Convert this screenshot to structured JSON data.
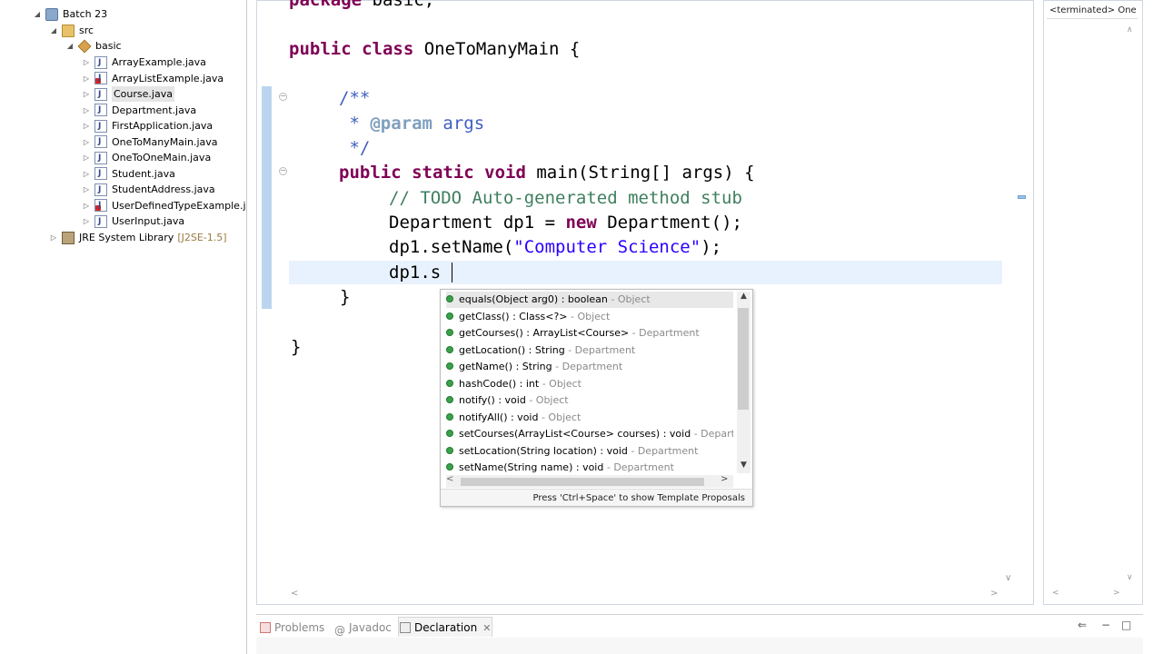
{
  "explorer": {
    "project": "Batch 23",
    "src": "src",
    "package": "basic",
    "files": [
      {
        "name": "ArrayExample.java",
        "error": false,
        "selected": false
      },
      {
        "name": "ArrayListExample.java",
        "error": true,
        "selected": false
      },
      {
        "name": "Course.java",
        "error": false,
        "selected": true
      },
      {
        "name": "Department.java",
        "error": false,
        "selected": false
      },
      {
        "name": "FirstApplication.java",
        "error": false,
        "selected": false
      },
      {
        "name": "OneToManyMain.java",
        "error": false,
        "selected": false
      },
      {
        "name": "OneToOneMain.java",
        "error": false,
        "selected": false
      },
      {
        "name": "Student.java",
        "error": false,
        "selected": false
      },
      {
        "name": "StudentAddress.java",
        "error": false,
        "selected": false
      },
      {
        "name": "UserDefinedTypeExample.ja",
        "error": true,
        "selected": false
      },
      {
        "name": "UserInput.java",
        "error": false,
        "selected": false
      }
    ],
    "library": {
      "name": "JRE System Library",
      "suffix": "[J2SE-1.5]"
    }
  },
  "editor": {
    "lines": {
      "pkg_kw": "package",
      "pkg_name": " basic;",
      "class_kw": "public class",
      "class_name": " OneToManyMain {",
      "jd_open": "/**",
      "jd_star": " * ",
      "jd_tag": "@param",
      "jd_args": " args",
      "jd_close": " */",
      "main_kw": "public static void",
      "main_rest": " main(String[] args) {",
      "todo": "// TODO Auto-generated method stub",
      "dep_decl_a": "Department dp1 = ",
      "dep_new": "new",
      "dep_decl_b": " Department();",
      "setname_a": "dp1.setName(",
      "setname_str": "\"Computer Science\"",
      "setname_b": ");",
      "typing": "dp1.s",
      "close_method": "}",
      "close_class": "}"
    }
  },
  "assist": {
    "proposals": [
      {
        "sig": "equals(Object arg0) : boolean",
        "decl": " - Object",
        "selected": true
      },
      {
        "sig": "getClass() : Class<?>",
        "decl": " - Object",
        "selected": false
      },
      {
        "sig": "getCourses() : ArrayList<Course>",
        "decl": " - Department",
        "selected": false
      },
      {
        "sig": "getLocation() : String",
        "decl": " - Department",
        "selected": false
      },
      {
        "sig": "getName() : String",
        "decl": " - Department",
        "selected": false
      },
      {
        "sig": "hashCode() : int",
        "decl": " - Object",
        "selected": false
      },
      {
        "sig": "notify() : void",
        "decl": " - Object",
        "selected": false
      },
      {
        "sig": "notifyAll() : void",
        "decl": " - Object",
        "selected": false
      },
      {
        "sig": "setCourses(ArrayList<Course> courses) : void",
        "decl": " - Departme",
        "selected": false
      },
      {
        "sig": "setLocation(String location) : void",
        "decl": " - Department",
        "selected": false
      },
      {
        "sig": "setName(String name) : void",
        "decl": " - Department",
        "selected": false
      }
    ],
    "status": "Press 'Ctrl+Space' to show Template Proposals"
  },
  "console": {
    "terminated": "<terminated> One"
  },
  "bottom_tabs": {
    "problems": "Problems",
    "javadoc": "Javadoc",
    "declaration": "Declaration"
  },
  "colors": {
    "keyword": "#7f0055",
    "comment": "#3f7f5f",
    "javadoc": "#3f5fbf",
    "string": "#2a00ff",
    "current_line": "#e8f2fe"
  }
}
